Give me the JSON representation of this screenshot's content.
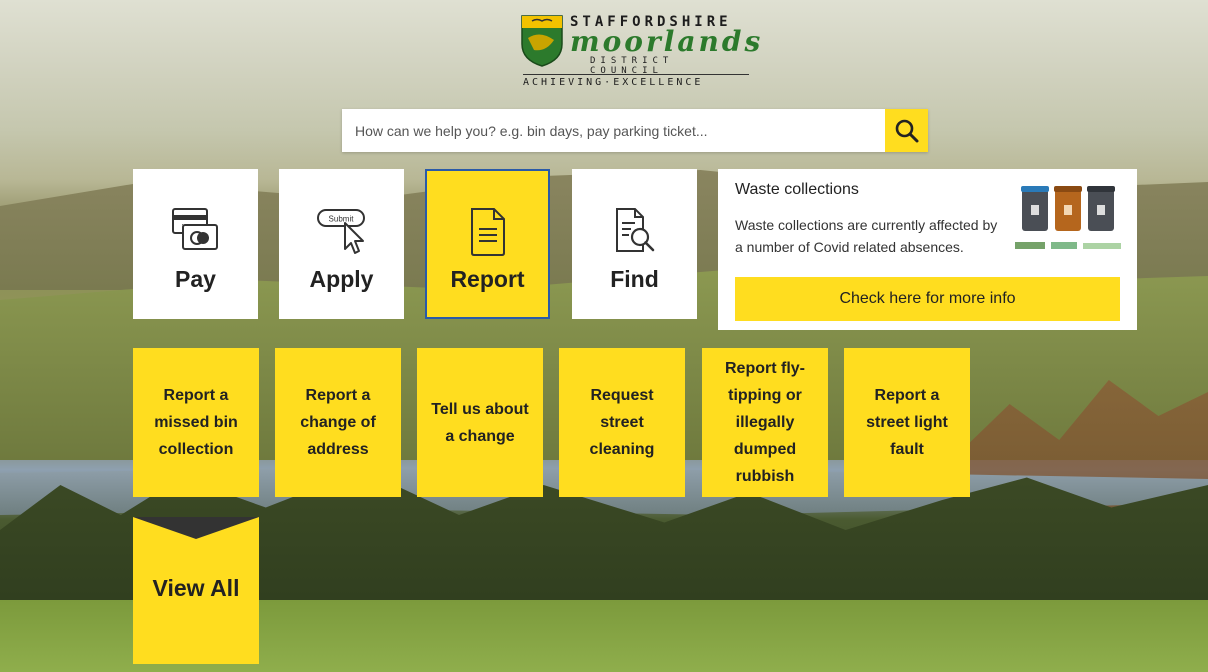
{
  "logo": {
    "line1": "STAFFORDSHIRE",
    "line2": "moorlands",
    "line3": "DISTRICT COUNCIL",
    "tagline": "ACHIEVING·EXCELLENCE"
  },
  "search": {
    "placeholder": "How can we help you? e.g. bin days, pay parking ticket...",
    "button_icon": "search-icon"
  },
  "main_tiles": [
    {
      "label": "Pay",
      "icon": "payment-card-icon",
      "active": false
    },
    {
      "label": "Apply",
      "icon": "submit-cursor-icon",
      "active": false
    },
    {
      "label": "Report",
      "icon": "document-icon",
      "active": true
    },
    {
      "label": "Find",
      "icon": "document-search-icon",
      "active": false
    }
  ],
  "waste_panel": {
    "title": "Waste collections",
    "description": "Waste collections are currently affected by a number of Covid related absences.",
    "button": "Check here for more info",
    "bins_icon": "wheelie-bins-icon",
    "partner_logos": "partner-logos"
  },
  "report_tiles": [
    "Report a missed bin collection",
    "Report a change of address",
    "Tell us about a change",
    "Request street cleaning",
    "Report fly-tipping or illegally dumped rubbish",
    "Report a street light fault"
  ],
  "view_all": {
    "label": "View All",
    "icon": "chevron-down-icon"
  },
  "colors": {
    "accent": "#ffdd1f",
    "active_border": "#2a5aa8",
    "text": "#222222",
    "logo_green": "#2c7a2c"
  }
}
